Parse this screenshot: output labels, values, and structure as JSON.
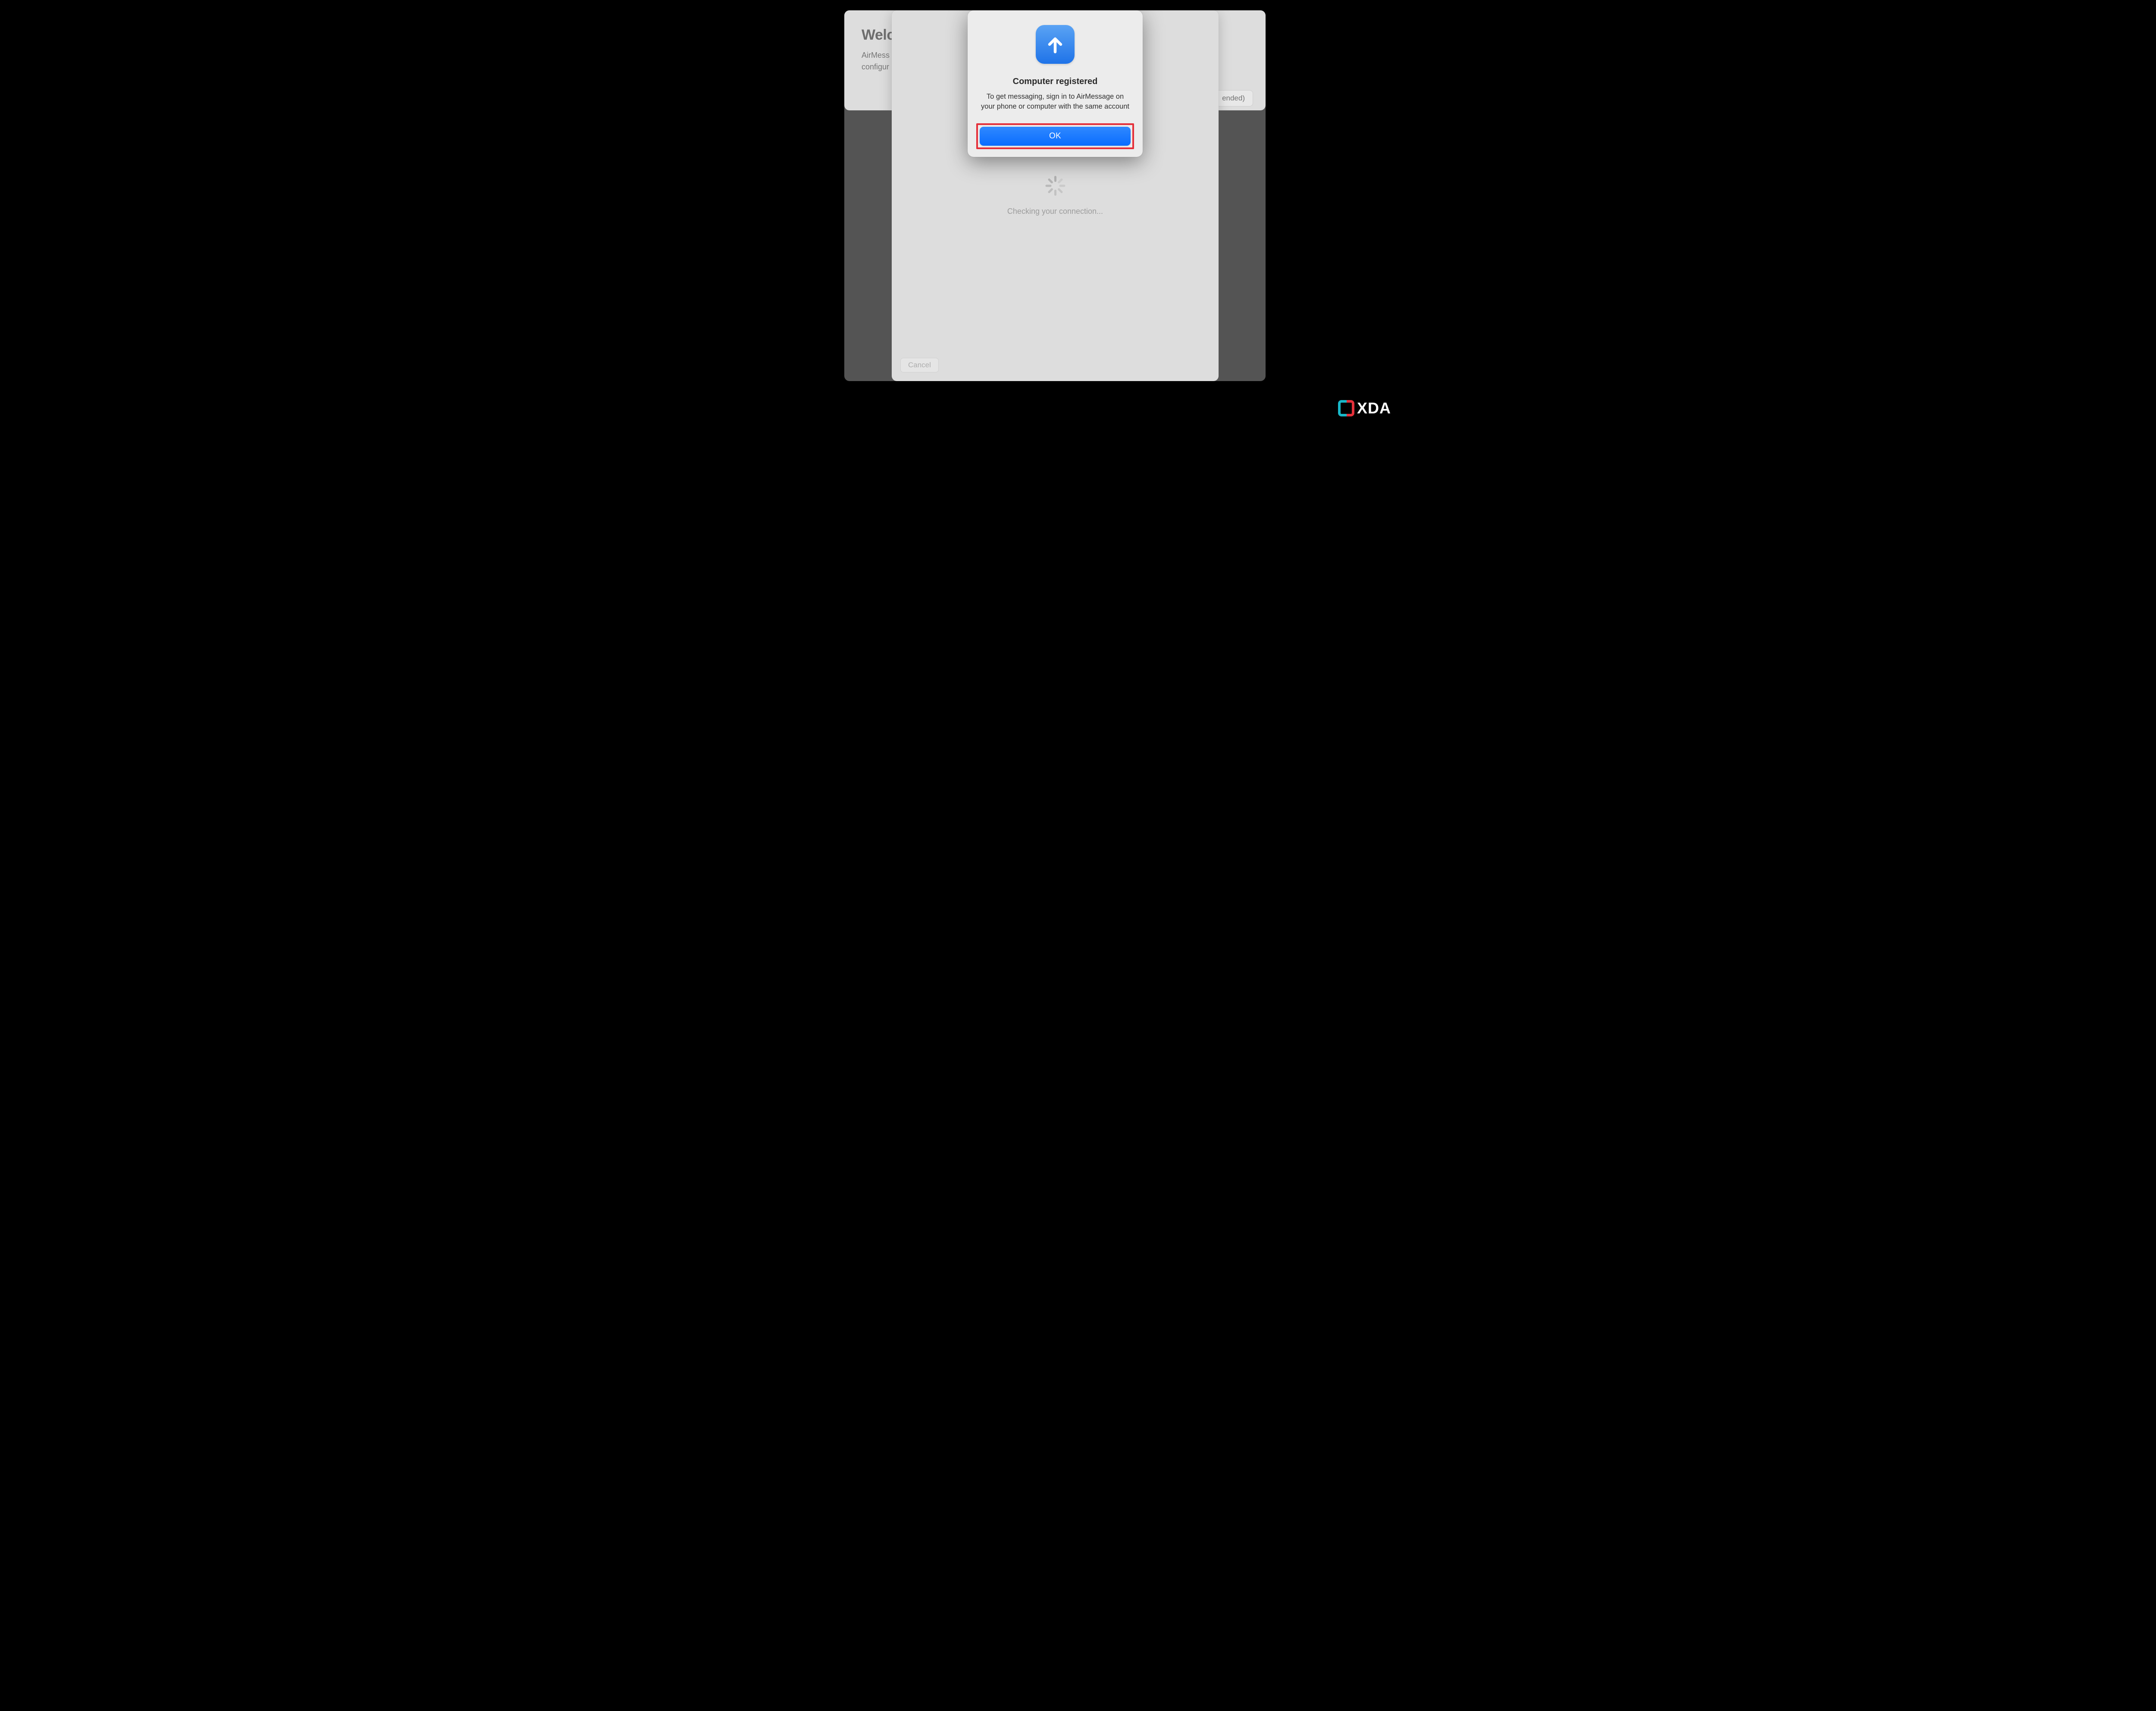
{
  "welcome": {
    "title_visible": "Welc",
    "subtitle_line1_visible": "AirMess",
    "subtitle_line2_visible": "configur",
    "recommended_visible": "ended)"
  },
  "connection_sheet": {
    "status_text": "Checking your connection...",
    "cancel_label": "Cancel"
  },
  "alert": {
    "icon_name": "arrow-up-icon",
    "title": "Computer registered",
    "body": "To get messaging, sign in to AirMessage on your phone or computer with the same account",
    "ok_label": "OK",
    "highlight_color": "#e4303a",
    "accent_color": "#0a6cff"
  },
  "watermark": {
    "text": "XDA"
  }
}
